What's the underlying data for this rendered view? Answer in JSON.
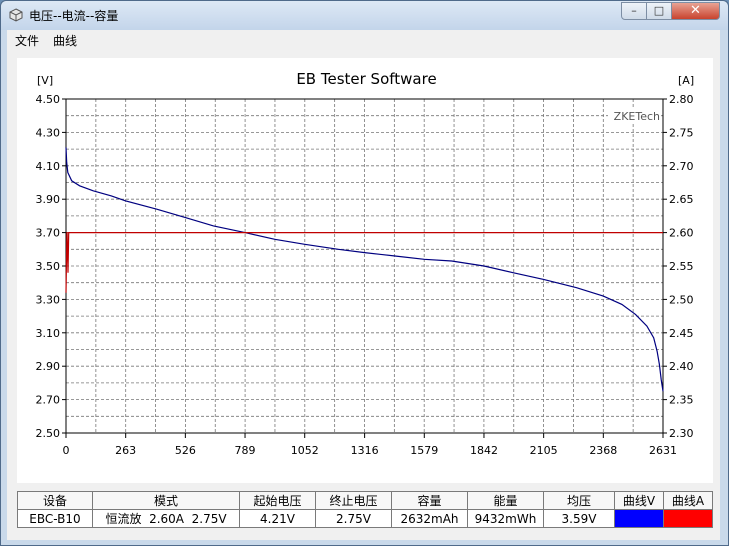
{
  "window": {
    "title": "电压--电流--容量",
    "min_glyph": "–",
    "max_glyph": "□",
    "close_glyph": "✕"
  },
  "menu": [
    "文件",
    "曲线"
  ],
  "chart_data": {
    "type": "line",
    "title": "EB Tester Software",
    "watermark": "ZKETech",
    "left_axis": {
      "unit": "[V]",
      "range": [
        2.5,
        4.5
      ],
      "ticks": [
        "2.50",
        "2.70",
        "2.90",
        "3.10",
        "3.30",
        "3.50",
        "3.70",
        "3.90",
        "4.10",
        "4.30",
        "4.50"
      ]
    },
    "right_axis": {
      "unit": "[A]",
      "range": [
        2.3,
        2.8
      ],
      "ticks": [
        "2.30",
        "2.35",
        "2.40",
        "2.45",
        "2.50",
        "2.55",
        "2.60",
        "2.65",
        "2.70",
        "2.75",
        "2.80"
      ]
    },
    "x_axis": {
      "range": [
        0,
        2631
      ],
      "ticks": [
        "0",
        "263",
        "526",
        "789",
        "1052",
        "1316",
        "1579",
        "1842",
        "2105",
        "2368",
        "2631"
      ]
    },
    "grid": true,
    "series": [
      {
        "axis": "left",
        "color": "#000080",
        "points": [
          [
            0,
            4.21
          ],
          [
            3,
            4.12
          ],
          [
            8,
            4.06
          ],
          [
            25,
            4.01
          ],
          [
            60,
            3.98
          ],
          [
            120,
            3.95
          ],
          [
            200,
            3.92
          ],
          [
            263,
            3.89
          ],
          [
            400,
            3.84
          ],
          [
            526,
            3.79
          ],
          [
            650,
            3.74
          ],
          [
            789,
            3.7
          ],
          [
            920,
            3.66
          ],
          [
            1052,
            3.63
          ],
          [
            1200,
            3.6
          ],
          [
            1316,
            3.58
          ],
          [
            1450,
            3.56
          ],
          [
            1579,
            3.54
          ],
          [
            1700,
            3.53
          ],
          [
            1842,
            3.5
          ],
          [
            1970,
            3.46
          ],
          [
            2105,
            3.42
          ],
          [
            2250,
            3.37
          ],
          [
            2368,
            3.32
          ],
          [
            2450,
            3.27
          ],
          [
            2510,
            3.21
          ],
          [
            2560,
            3.14
          ],
          [
            2590,
            3.07
          ],
          [
            2605,
            2.99
          ],
          [
            2615,
            2.91
          ],
          [
            2623,
            2.82
          ],
          [
            2631,
            2.75
          ]
        ]
      },
      {
        "axis": "right",
        "color": "#c00000",
        "points": [
          [
            0,
            2.51
          ],
          [
            4,
            2.6
          ],
          [
            5,
            2.6
          ],
          [
            9,
            2.54
          ],
          [
            12,
            2.6
          ],
          [
            2631,
            2.6
          ]
        ]
      }
    ]
  },
  "info_table": {
    "headers": [
      "设备",
      "模式",
      "起始电压",
      "终止电压",
      "容量",
      "能量",
      "均压",
      "曲线V",
      "曲线A"
    ],
    "values": [
      "EBC-B10",
      "恒流放  2.60A  2.75V",
      "4.21V",
      "2.75V",
      "2632mAh",
      "9432mWh",
      "3.59V"
    ],
    "swatches": {
      "voltage": "#0000ff",
      "current": "#ff0000"
    }
  }
}
